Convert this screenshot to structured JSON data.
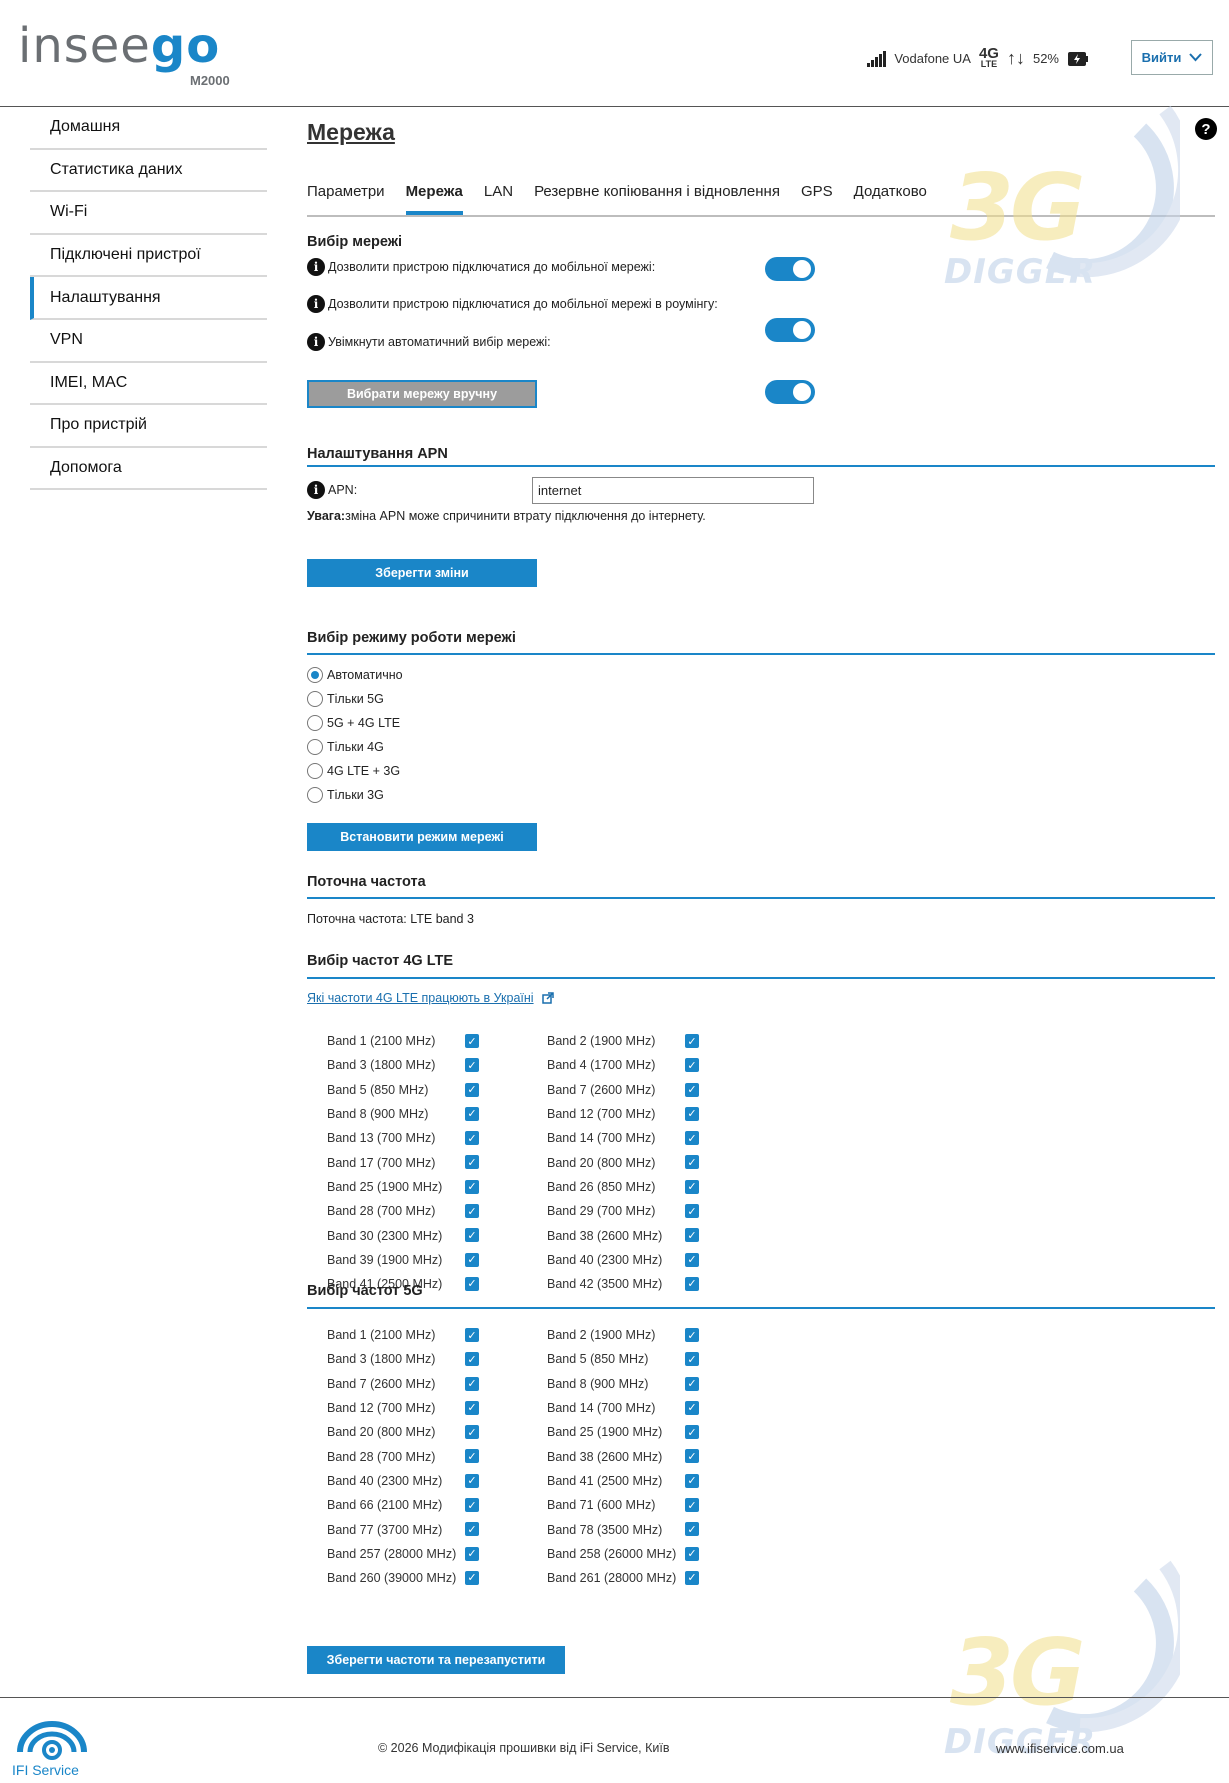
{
  "header": {
    "logo_part1": "insee",
    "logo_part2": "go",
    "model": "M2000",
    "carrier": "Vodafone UA",
    "network_type": "4G",
    "network_sub": "LTE",
    "battery": "52%",
    "logout_label": "Вийти"
  },
  "sidebar": {
    "items": [
      {
        "label": "Домашня"
      },
      {
        "label": "Статистика даних"
      },
      {
        "label": "Wi-Fi"
      },
      {
        "label": "Підключені пристрої"
      },
      {
        "label": "Налаштування"
      },
      {
        "label": "VPN"
      },
      {
        "label": "IMEI, MAC"
      },
      {
        "label": "Про пристрій"
      },
      {
        "label": "Допомога"
      }
    ],
    "active_index": 4
  },
  "page": {
    "title": "Мережа",
    "help": "?",
    "tabs": [
      {
        "label": "Параметри"
      },
      {
        "label": "Мережа"
      },
      {
        "label": "LAN"
      },
      {
        "label": "Резервне копіювання і відновлення"
      },
      {
        "label": "GPS"
      },
      {
        "label": "Додатково"
      }
    ],
    "active_tab": 1
  },
  "network_select": {
    "title": "Вибір мережі",
    "rows": [
      {
        "label": "Дозволити пристрою підключатися до мобільної мережі:",
        "on": true
      },
      {
        "label": "Дозволити пристрою підключатися до мобільної мережі в роумінгу:",
        "on": true
      },
      {
        "label": "Увімкнути автоматичний вибір мережі:",
        "on": true
      }
    ],
    "manual_button": "Вибрати мережу вручну"
  },
  "apn": {
    "title": "Налаштування APN",
    "label": "APN:",
    "value": "internet",
    "warning_bold": "Увага:",
    "warning_text": " зміна APN може спричинити втрату підключення до інтернету.",
    "save_button": "Зберегти зміни"
  },
  "mode": {
    "title": "Вибір режиму роботи мережі",
    "options": [
      "Автоматично",
      "Тільки 5G",
      "5G + 4G LTE",
      "Тільки 4G",
      "4G LTE + 3G",
      "Тільки 3G"
    ],
    "selected": 0,
    "set_button": "Встановити режим мережі"
  },
  "current": {
    "title": "Поточна частота",
    "text": "Поточна частота: LTE band 3"
  },
  "lte_bands": {
    "title": "Вибір частот 4G LTE",
    "link": "Які частоти 4G LTE працюють в Україні",
    "bands": [
      "Band 1 (2100 MHz)",
      "Band 2 (1900 MHz)",
      "Band 3 (1800 MHz)",
      "Band 4 (1700 MHz)",
      "Band 5 (850 MHz)",
      "Band 7 (2600 MHz)",
      "Band 8 (900 MHz)",
      "Band 12 (700 MHz)",
      "Band 13 (700 MHz)",
      "Band 14 (700 MHz)",
      "Band 17 (700 MHz)",
      "Band 20 (800 MHz)",
      "Band 25 (1900 MHz)",
      "Band 26 (850 MHz)",
      "Band 28 (700 MHz)",
      "Band 29 (700 MHz)",
      "Band 30 (2300 MHz)",
      "Band 38 (2600 MHz)",
      "Band 39 (1900 MHz)",
      "Band 40 (2300 MHz)",
      "Band 41 (2500 MHz)",
      "Band 42 (3500 MHz)"
    ]
  },
  "nr_bands": {
    "title": "Вибір частот 5G",
    "bands": [
      "Band 1 (2100 MHz)",
      "Band 2 (1900 MHz)",
      "Band 3 (1800 MHz)",
      "Band 5 (850 MHz)",
      "Band 7 (2600 MHz)",
      "Band 8 (900 MHz)",
      "Band 12 (700 MHz)",
      "Band 14 (700 MHz)",
      "Band 20 (800 MHz)",
      "Band 25 (1900 MHz)",
      "Band 28 (700 MHz)",
      "Band 38 (2600 MHz)",
      "Band 40 (2300 MHz)",
      "Band 41 (2500 MHz)",
      "Band 66 (2100 MHz)",
      "Band 71 (600 MHz)",
      "Band 77 (3700 MHz)",
      "Band 78 (3500 MHz)",
      "Band 257 (28000 MHz)",
      "Band 258 (26000 MHz)",
      "Band 260 (39000 MHz)",
      "Band 261 (28000 MHz)"
    ],
    "save_button": "Зберегти частоти та перезапустити"
  },
  "footer": {
    "copyright": "© 2026 Модифікація прошивки від iFi Service, Київ",
    "site": "www.ifiservice.com.ua",
    "brand": "IFI Service"
  },
  "watermark": {
    "big": "3G",
    "small": "DIGGER"
  },
  "colors": {
    "accent": "#1a86c8",
    "brand_gray": "#6b6f73"
  }
}
